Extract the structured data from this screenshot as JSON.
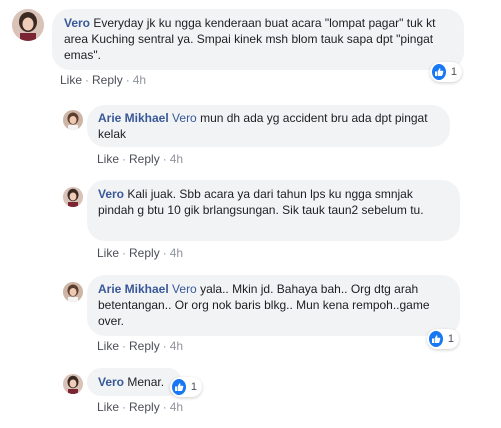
{
  "comments": [
    {
      "author": "Vero",
      "tag": "",
      "text": "Everyday jk ku ngga kenderaan buat acara \"lompat pagar\" tuk kt area Kuching sentral ya. Smpai kinek msh blom tauk sapa dpt \"pingat emas\".",
      "like": "Like",
      "reply": "Reply",
      "time": "4h",
      "reactions": "1"
    },
    {
      "author": "Arie Mikhael",
      "tag": "Vero",
      "text": " mun dh ada yg accident bru ada dpt pingat kelak",
      "like": "Like",
      "reply": "Reply",
      "time": "4h",
      "reactions": ""
    },
    {
      "author": "Vero",
      "tag": "",
      "text": "Kali juak. Sbb acara ya dari tahun lps ku ngga smnjak pindah g btu 10 gik brlangsungan. Sik tauk taun2 sebelum tu.",
      "like": "Like",
      "reply": "Reply",
      "time": "4h",
      "reactions": ""
    },
    {
      "author": "Arie Mikhael",
      "tag": "Vero",
      "text": " yala.. Mkin jd. Bahaya bah.. Org dtg arah betentangan.. Or org nok baris blkg.. Mun kena rempoh..game over.",
      "like": "Like",
      "reply": "Reply",
      "time": "4h",
      "reactions": "1"
    },
    {
      "author": "Vero",
      "tag": "",
      "text": "Menar.",
      "like": "Like",
      "reply": "Reply",
      "time": "4h",
      "reactions": "1"
    }
  ],
  "colors": {
    "author": "#385898",
    "bubble": "#f2f3f5",
    "like_blue": "#1877f2",
    "meta": "#90949c"
  },
  "icons": {
    "reaction": "like-thumbs-up-icon"
  }
}
